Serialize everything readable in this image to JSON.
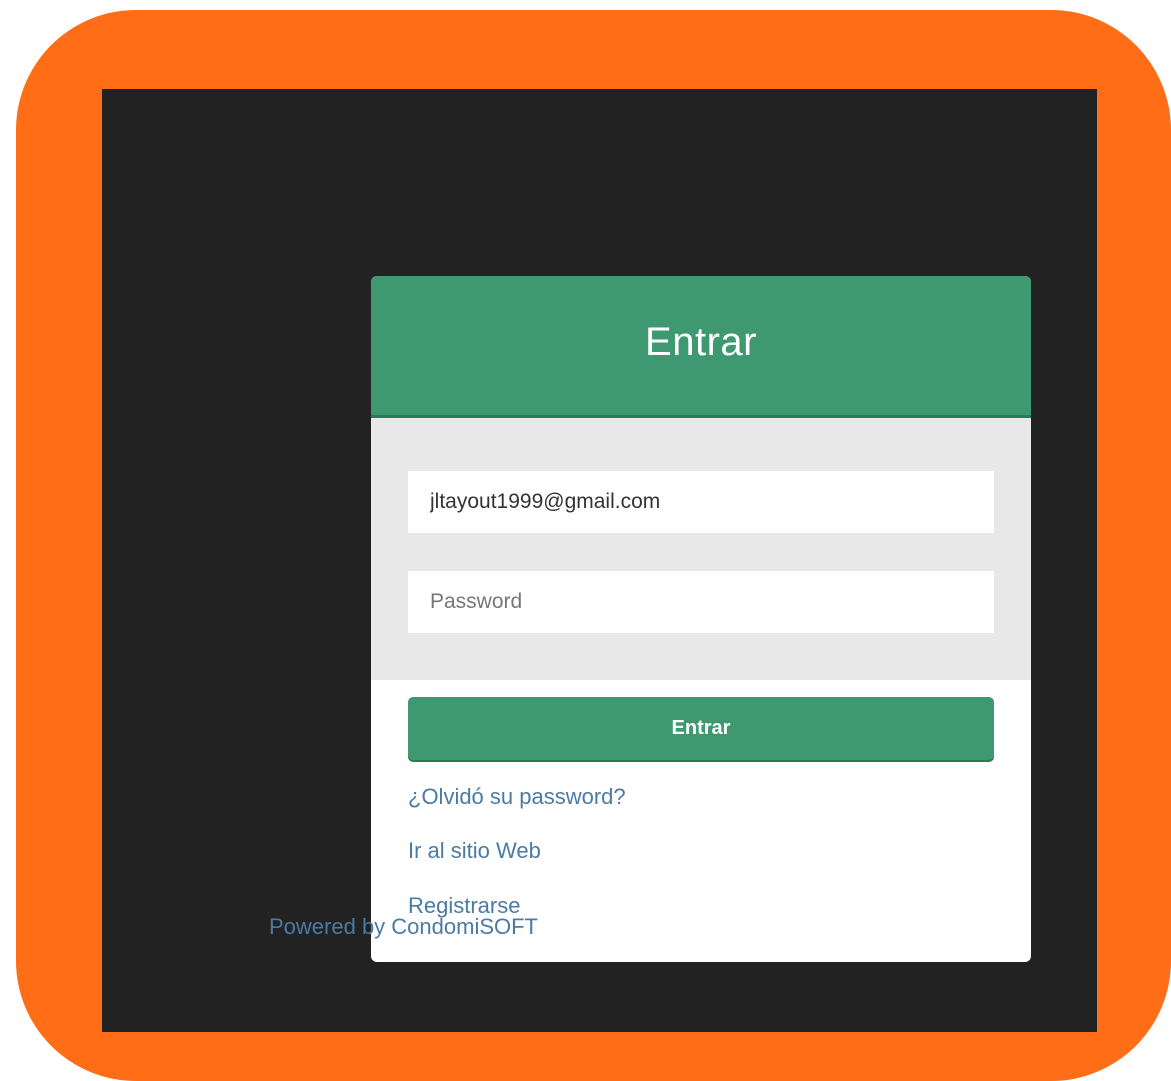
{
  "login": {
    "title": "Entrar",
    "email_value": "jltayout1999@gmail.com",
    "password_placeholder": "Password",
    "submit_label": "Entrar",
    "forgot_link": "¿Olvidó su password?",
    "website_link": "Ir al sitio Web",
    "register_link": "Registrarse"
  },
  "footer": {
    "powered_by": "Powered by CondomiSOFT"
  },
  "colors": {
    "frame": "#ff6d16",
    "background": "#222222",
    "header": "#3e9970",
    "body": "#e8e8e9",
    "link": "#4a7ba5"
  }
}
